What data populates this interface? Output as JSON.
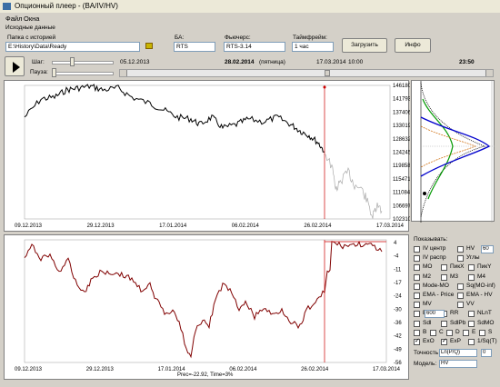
{
  "window": {
    "title": "Опционный плеер - (BA/IV/HV)"
  },
  "menu": [
    "Файл",
    "Окна"
  ],
  "source": {
    "group_label": "Исходные данные",
    "folder_label": "Папка с историей",
    "folder_value": "E:\\History\\Data\\Ready",
    "ba_label": "БА:",
    "ba_value": "RTS",
    "futures_label": "Фьючерс:",
    "futures_value": "RTS-3.14",
    "timeframe_label": "Таймфрейм:",
    "timeframe_value": "1 час",
    "load_button": "Загрузить",
    "info_button": "Инфо"
  },
  "player": {
    "step_label": "Шаг:",
    "pause_label": "Пауза:",
    "start_date": "05.12.2013",
    "current_date": "28.02.2014",
    "current_day": "(пятница)",
    "end_date": "17.03.2014",
    "start_time": "10:00",
    "end_time": "23:50",
    "step_position": 0.32,
    "pause_position": 0.0
  },
  "top_chart": {
    "y_ticks": [
      "146180",
      "141793",
      "137406",
      "133019",
      "128632",
      "124245",
      "119858",
      "115471",
      "111084",
      "106697",
      "102310"
    ],
    "x_ticks": [
      "09.12.2013",
      "29.12.2013",
      "17.01.2014",
      "06.02.2014",
      "26.02.2014",
      "17.03.2014"
    ]
  },
  "bottom_chart": {
    "y_ticks": [
      "4",
      "-4",
      "-11",
      "-17",
      "-24",
      "-30",
      "-36",
      "-42",
      "-49",
      "-56"
    ],
    "x_ticks": [
      "09.12.2013",
      "29.12.2013",
      "17.01.2014",
      "06.02.2014",
      "26.02.2014",
      "17.03.2014"
    ],
    "footer": "Prec=-22.92, Time=3%"
  },
  "right_panel": {
    "show_label": "Показывать:",
    "options": [
      {
        "label": "IV центр",
        "checked": false
      },
      {
        "label": "HV",
        "checked": false
      },
      {
        "label": "IV распр",
        "checked": false
      },
      {
        "label": "Углы",
        "checked": false
      },
      {
        "label": "МО",
        "checked": false
      },
      {
        "label": "ПикХ",
        "checked": false
      },
      {
        "label": "ПикY",
        "checked": false
      },
      {
        "label": "М2",
        "checked": false
      },
      {
        "label": "М3",
        "checked": false
      },
      {
        "label": "М4",
        "checked": false
      },
      {
        "label": "Mode-MO",
        "checked": false
      },
      {
        "label": "Sq(MO-inf)",
        "checked": false
      },
      {
        "label": "EMA - Price",
        "checked": false
      },
      {
        "label": "EMA - HV",
        "checked": false
      },
      {
        "label": "MV",
        "checked": false
      },
      {
        "label": "VV",
        "checked": false
      },
      {
        "label": "BF",
        "checked": false
      },
      {
        "label": "RR",
        "checked": false
      },
      {
        "label": "NLnT",
        "checked": false
      },
      {
        "label": "Sdl",
        "checked": false
      },
      {
        "label": "SdlPb",
        "checked": false
      },
      {
        "label": "SdMO",
        "checked": false
      },
      {
        "label": "B",
        "checked": false
      },
      {
        "label": "C",
        "checked": false
      },
      {
        "label": "D",
        "checked": false
      },
      {
        "label": "E",
        "checked": false
      },
      {
        "label": "S",
        "checked": false
      },
      {
        "label": "ExO",
        "checked": true
      },
      {
        "label": "ExP",
        "checked": true
      },
      {
        "label": "1/Sq(T)",
        "checked": false
      }
    ],
    "hv_value": "60",
    "mv_value": "600",
    "accuracy_label": "Точность",
    "accuracy_value": "Ln(P/Q)",
    "accuracy_num": "0",
    "model_label": "Модель:",
    "model_value": "HV"
  }
}
